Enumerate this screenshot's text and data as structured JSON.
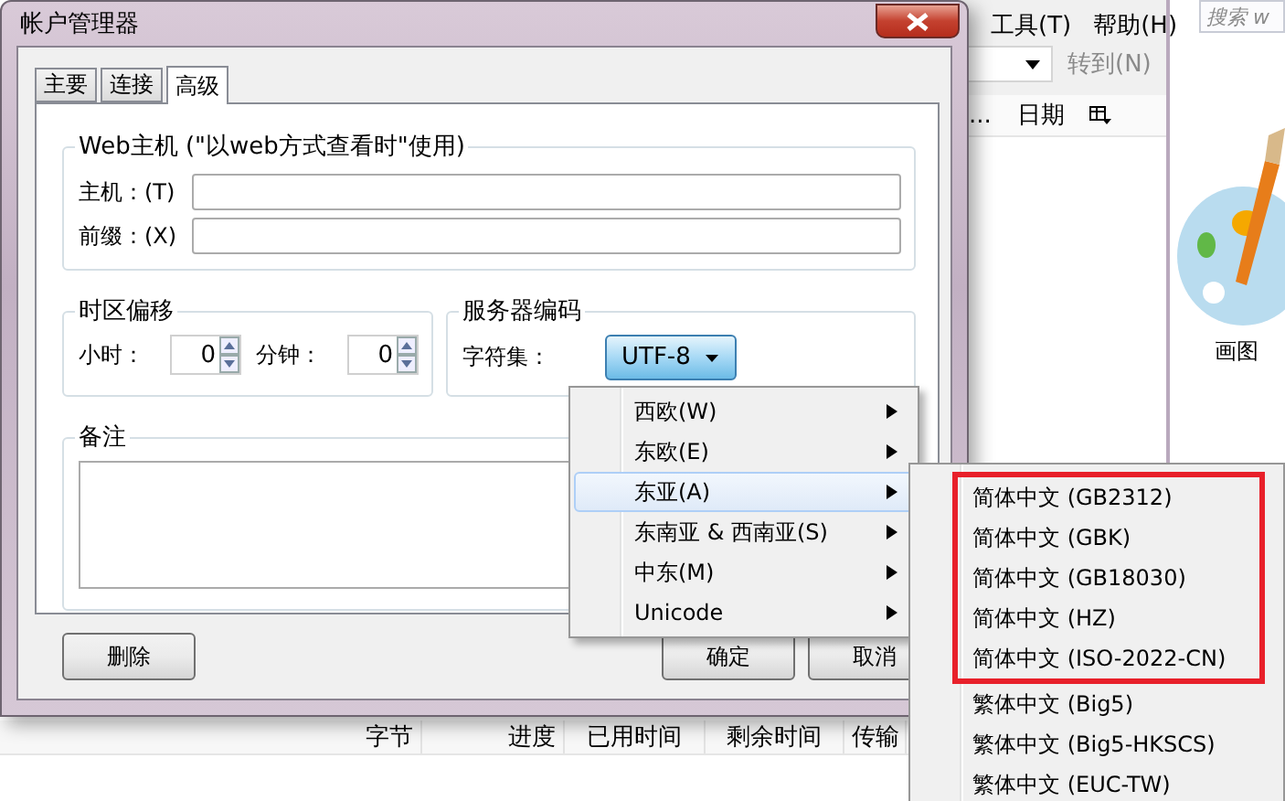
{
  "background_window": {
    "menu": [
      "工具(T)",
      "帮助(H)"
    ],
    "go_button": {
      "label": "转到(N)",
      "disabled": true
    },
    "columns": [
      "...",
      "日期"
    ]
  },
  "search": {
    "placeholder": "搜索 w"
  },
  "desktop_icon": {
    "label": "画图"
  },
  "transfer_columns": [
    "字节",
    "进度",
    "已用时间",
    "剩余时间",
    "传输"
  ],
  "dialog": {
    "title": "帐户管理器",
    "tabs": [
      {
        "label": "主要",
        "selected": false
      },
      {
        "label": "连接",
        "selected": false
      },
      {
        "label": "高级",
        "selected": true
      }
    ],
    "web_host": {
      "title": "Web主机 (\"以web方式查看时\"使用)",
      "fields": [
        {
          "label": "主机：(T)"
        },
        {
          "label": "前缀：(X)"
        }
      ]
    },
    "timezone": {
      "title": "时区偏移",
      "spinners": [
        {
          "label": "小时：",
          "value": "0"
        },
        {
          "label": "分钟：",
          "value": "0"
        }
      ]
    },
    "encoding": {
      "title": "服务器编码",
      "label": "字符集：",
      "value": "UTF-8"
    },
    "notes": {
      "title": "备注"
    },
    "buttons": [
      "删除",
      "确定",
      "取消"
    ]
  },
  "charset_menu": [
    {
      "label": "西欧(W)",
      "selected": false
    },
    {
      "label": "东欧(E)",
      "selected": false
    },
    {
      "label": "东亚(A)",
      "selected": true
    },
    {
      "label": "东南亚 & 西南亚(S)",
      "selected": false
    },
    {
      "label": "中东(M)",
      "selected": false
    },
    {
      "label": "Unicode",
      "selected": false
    }
  ],
  "submenu": [
    {
      "label": "简体中文 (GB2312)",
      "highlighted": true
    },
    {
      "label": "简体中文 (GBK)",
      "highlighted": true
    },
    {
      "label": "简体中文 (GB18030)",
      "highlighted": true
    },
    {
      "label": "简体中文 (HZ)",
      "highlighted": true
    },
    {
      "label": "简体中文 (ISO-2022-CN)",
      "highlighted": true
    },
    {
      "label": "繁体中文 (Big5)",
      "highlighted": false
    },
    {
      "label": "繁体中文 (Big5-HKSCS)",
      "highlighted": false
    },
    {
      "label": "繁体中文 (EUC-TW)",
      "highlighted": false
    }
  ]
}
